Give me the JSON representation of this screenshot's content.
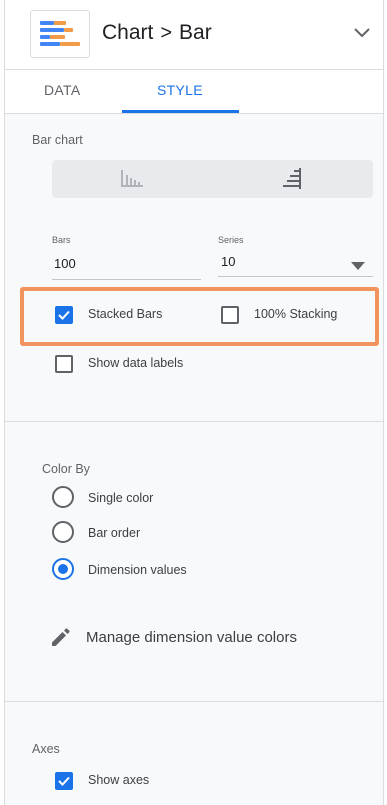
{
  "header": {
    "title_part1": "Chart",
    "separator": ">",
    "title_part2": "Bar",
    "icon": "bar-chart-icon",
    "chart_icon_colors": [
      "#4285f4",
      "#f29c4a"
    ],
    "menu_icon": "chevron-down-icon"
  },
  "tabs": [
    {
      "label": "DATA",
      "active": false
    },
    {
      "label": "STYLE",
      "active": true
    }
  ],
  "bar_chart": {
    "section_label": "Bar chart",
    "orientation": {
      "vertical_icon": "vertical-bars-icon",
      "horizontal_icon": "horizontal-bars-icon",
      "selected": "horizontal"
    },
    "bars": {
      "label": "Bars",
      "value": "100"
    },
    "series": {
      "label": "Series",
      "value": "10"
    },
    "stacked_bars": {
      "label": "Stacked Bars",
      "checked": true
    },
    "percent_stacking": {
      "label": "100% Stacking",
      "checked": false
    },
    "show_data_labels": {
      "label": "Show data labels",
      "checked": false
    }
  },
  "color_by": {
    "section_label": "Color By",
    "options": [
      {
        "label": "Single color",
        "selected": false
      },
      {
        "label": "Bar order",
        "selected": false
      },
      {
        "label": "Dimension values",
        "selected": true
      }
    ],
    "manage_label": "Manage dimension value colors",
    "manage_icon": "pencil-icon"
  },
  "axes": {
    "section_label": "Axes",
    "show_axes": {
      "label": "Show axes",
      "checked": true
    }
  },
  "colors": {
    "accent": "#1a73e8",
    "highlight": "#f0935c"
  }
}
